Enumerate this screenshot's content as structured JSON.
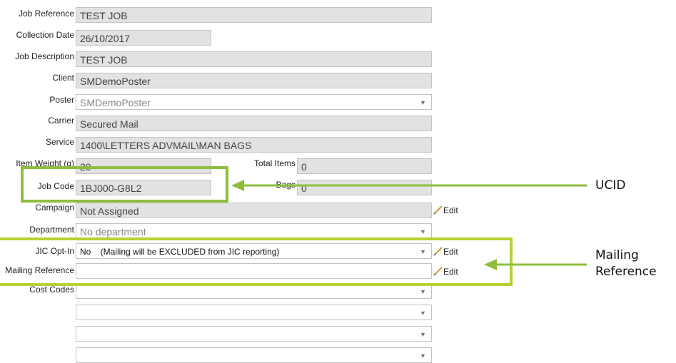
{
  "form": {
    "job_reference": {
      "label": "Job Reference",
      "value": "TEST JOB"
    },
    "collection_date": {
      "label": "Collection Date",
      "value": "26/10/2017"
    },
    "job_description": {
      "label": "Job Description",
      "value": "TEST JOB"
    },
    "client": {
      "label": "Client",
      "value": "SMDemoPoster"
    },
    "poster": {
      "label": "Poster",
      "value": "SMDemoPoster"
    },
    "carrier": {
      "label": "Carrier",
      "value": "Secured Mail"
    },
    "service": {
      "label": "Service",
      "value": "1400\\LETTERS ADVMAIL\\MAN BAGS"
    },
    "item_weight": {
      "label": "Item Weight (g)",
      "value": "20"
    },
    "total_items": {
      "label": "Total Items",
      "value": "0"
    },
    "job_code": {
      "label": "Job Code",
      "value": "1BJ000-G8L2"
    },
    "bags": {
      "label": "Bags",
      "value": "0"
    },
    "campaign": {
      "label": "Campaign",
      "value": "Not Assigned",
      "edit": "Edit"
    },
    "department": {
      "label": "Department",
      "value": "No department"
    },
    "jic_opt_in": {
      "label": "JIC Opt-In",
      "value": "No    (Mailing will be EXCLUDED from JIC reporting)",
      "edit": "Edit"
    },
    "mailing_reference": {
      "label": "Mailing Reference",
      "value": "",
      "edit": "Edit"
    },
    "cost_codes": {
      "label": "Cost Codes",
      "values": [
        "",
        "",
        "",
        "",
        ""
      ]
    }
  },
  "annotations": {
    "ucid": "UCID",
    "mailing_reference_line1": "Mailing",
    "mailing_reference_line2": "Reference"
  },
  "colors": {
    "highlight": "#8fbe3e",
    "highlight_bright": "#b4d234",
    "field_bg": "#e2e2e2"
  }
}
